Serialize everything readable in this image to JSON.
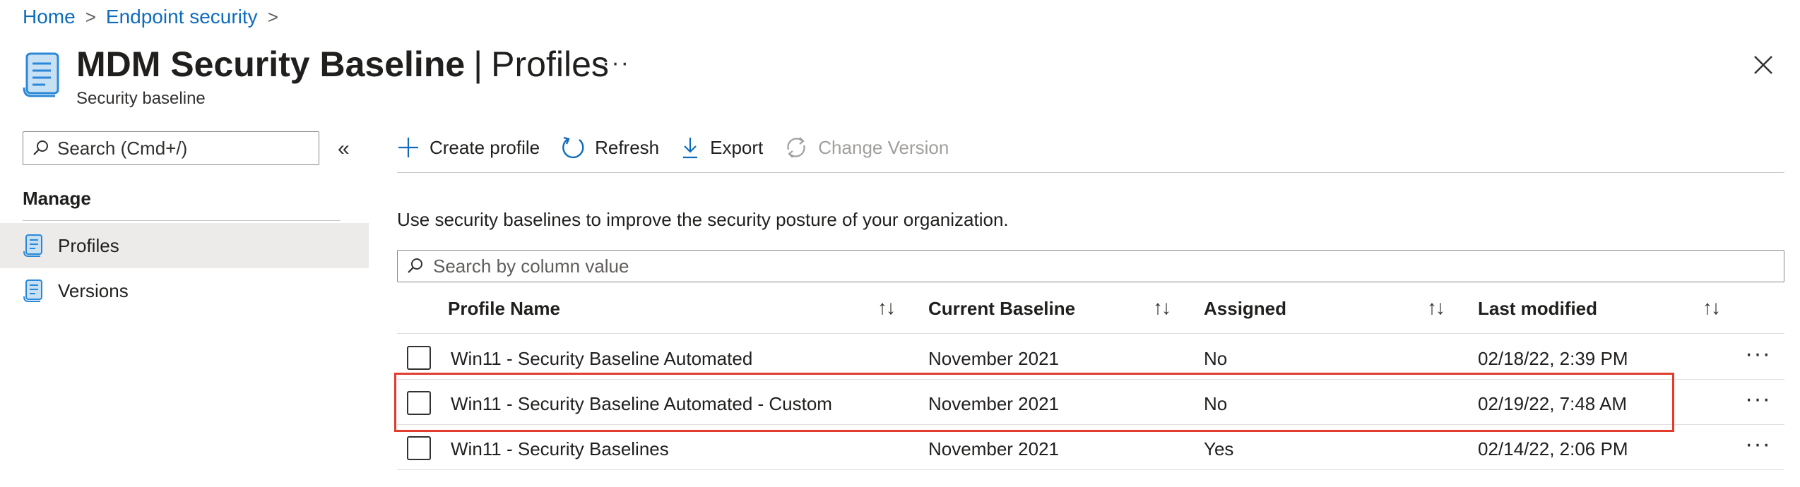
{
  "breadcrumb": {
    "home": "Home",
    "endpoint": "Endpoint security",
    "sep": ">"
  },
  "header": {
    "title_bold": "MDM Security Baseline",
    "title_pipe": "|",
    "title_light": "Profiles",
    "more": "···",
    "subtitle": "Security baseline"
  },
  "sidebar": {
    "search_placeholder": "Search (Cmd+/)",
    "collapse": "«",
    "section": "Manage",
    "items": [
      {
        "label": "Profiles"
      },
      {
        "label": "Versions"
      }
    ]
  },
  "toolbar": {
    "create": "Create profile",
    "refresh": "Refresh",
    "export": "Export",
    "change_version": "Change Version"
  },
  "description": "Use security baselines to improve the security posture of your organization.",
  "filter_placeholder": "Search by column value",
  "table": {
    "columns": [
      "Profile Name",
      "Current Baseline",
      "Assigned",
      "Last modified"
    ],
    "sort_glyph": "↑↓",
    "row_more": "···",
    "rows": [
      {
        "name": "Win11 - Security Baseline Automated",
        "baseline": "November 2021",
        "assigned": "No",
        "modified": "02/18/22, 2:39 PM"
      },
      {
        "name": "Win11 - Security Baseline Automated - Custom",
        "baseline": "November 2021",
        "assigned": "No",
        "modified": "02/19/22, 7:48 AM"
      },
      {
        "name": "Win11 - Security Baselines",
        "baseline": "November 2021",
        "assigned": "Yes",
        "modified": "02/14/22, 2:06 PM"
      }
    ]
  },
  "colors": {
    "link": "#0f6cbd",
    "highlight": "#e33b2e",
    "icon": "#2b88d8"
  }
}
